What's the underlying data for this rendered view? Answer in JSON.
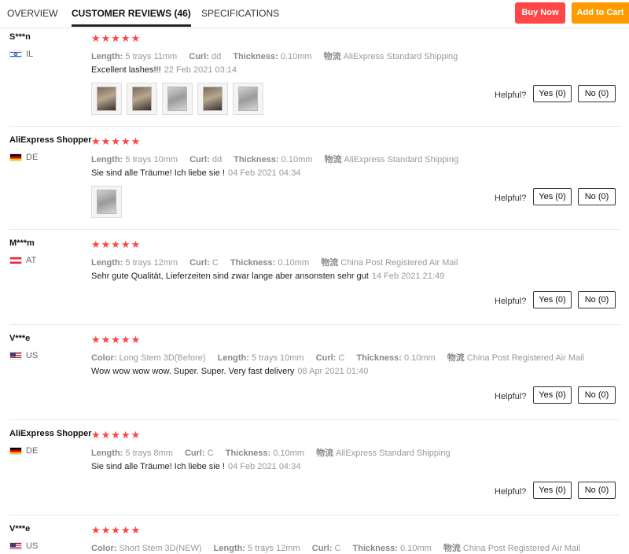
{
  "tabs": {
    "overview": "OVERVIEW",
    "reviews": "CUSTOMER REVIEWS (46)",
    "specs": "SPECIFICATIONS"
  },
  "actions": {
    "buy_now": "Buy Now",
    "add_to_cart": "Add to Cart"
  },
  "colors": {
    "buy_now": "#ff4747",
    "add_to_cart": "#ff9a00",
    "stars": "#ff4444"
  },
  "helpful_label": "Helpful?",
  "yes_label": "Yes (0)",
  "no_label": "No (0)",
  "stars": "★★★★★",
  "reviews": [
    {
      "name": "S***n",
      "country": "IL",
      "length_k": "Length:",
      "length": "5 trays 11mm",
      "curl_k": "Curl:",
      "curl": "dd",
      "thick_k": "Thickness:",
      "thick": "0.10mm",
      "ship_k": "物流",
      "ship": "AliExpress Standard Shipping",
      "text": "Excellent lashes!!!",
      "date": "22 Feb 2021 03:14"
    },
    {
      "name": "AliExpress Shopper",
      "country": "DE",
      "length_k": "Length:",
      "length": "5 trays 10mm",
      "curl_k": "Curl:",
      "curl": "dd",
      "thick_k": "Thickness:",
      "thick": "0.10mm",
      "ship_k": "物流",
      "ship": "AliExpress Standard Shipping",
      "text": "Sie sind alle Träume! Ich liebe sie !",
      "date": "04 Feb 2021 04:34"
    },
    {
      "name": "M***m",
      "country": "AT",
      "length_k": "Length:",
      "length": "5 trays 12mm",
      "curl_k": "Curl:",
      "curl": "C",
      "thick_k": "Thickness:",
      "thick": "0.10mm",
      "ship_k": "物流",
      "ship": "China Post Registered Air Mail",
      "text": "Sehr gute Qualität, Lieferzeiten sind zwar lange aber ansonsten sehr gut",
      "date": "14 Feb 2021 21:49"
    },
    {
      "name": "V***e",
      "country": "US",
      "color_k": "Color:",
      "color": "Long Stem 3D(Before)",
      "length_k": "Length:",
      "length": "5 trays 10mm",
      "curl_k": "Curl:",
      "curl": "C",
      "thick_k": "Thickness:",
      "thick": "0.10mm",
      "ship_k": "物流",
      "ship": "China Post Registered Air Mail",
      "text": "Wow wow wow wow. Super. Super. Very fast delivery",
      "date": "08 Apr 2021 01:40"
    },
    {
      "name": "AliExpress Shopper",
      "country": "DE",
      "length_k": "Length:",
      "length": "5 trays 8mm",
      "curl_k": "Curl:",
      "curl": "C",
      "thick_k": "Thickness:",
      "thick": "0.10mm",
      "ship_k": "物流",
      "ship": "AliExpress Standard Shipping",
      "text": "Sie sind alle Träume! Ich liebe sie !",
      "date": "04 Feb 2021 04:34"
    },
    {
      "name": "V***e",
      "country": "US",
      "color_k": "Color:",
      "color": "Short Stem 3D(NEW)",
      "length_k": "Length:",
      "length": "5 trays 12mm",
      "curl_k": "Curl:",
      "curl": "C",
      "thick_k": "Thickness:",
      "thick": "0.10mm",
      "ship_k": "物流",
      "ship": "China Post Registered Air Mail"
    }
  ]
}
